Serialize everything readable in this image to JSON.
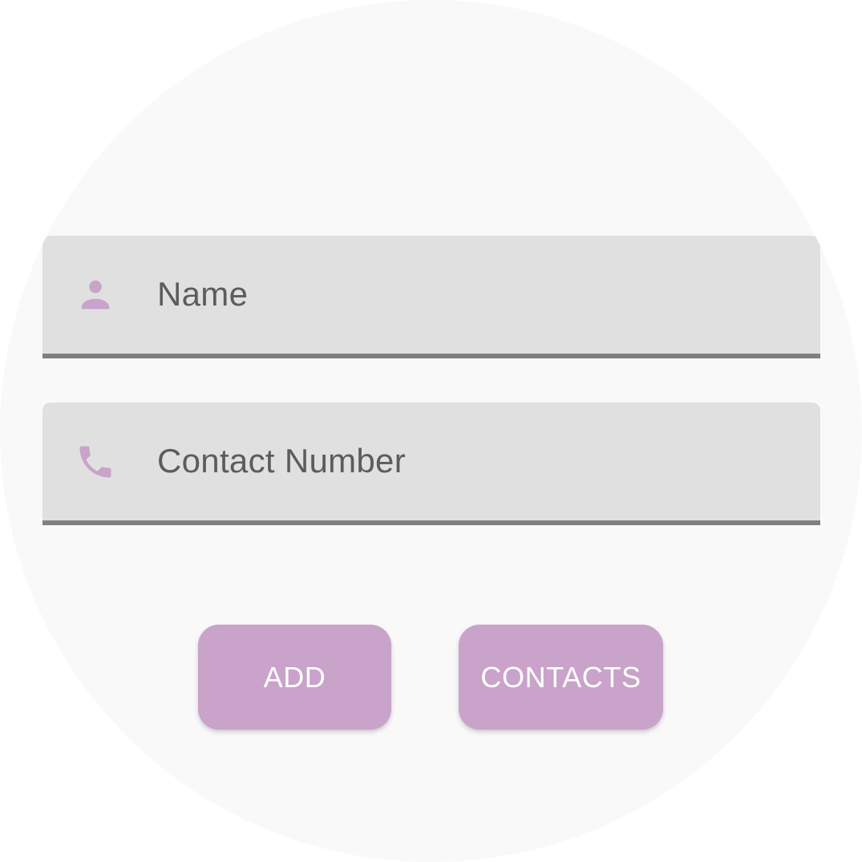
{
  "form": {
    "name_field": {
      "placeholder": "Name",
      "icon": "person-icon"
    },
    "phone_field": {
      "placeholder": "Contact Number",
      "icon": "phone-icon"
    }
  },
  "actions": {
    "add_label": "ADD",
    "contacts_label": "CONTACTS"
  },
  "colors": {
    "accent": "#c9a3c9",
    "field_background": "#e0e0e0",
    "field_underline": "#808080",
    "placeholder_text": "#5c5c5c",
    "screen_background": "#f9f9f9"
  }
}
